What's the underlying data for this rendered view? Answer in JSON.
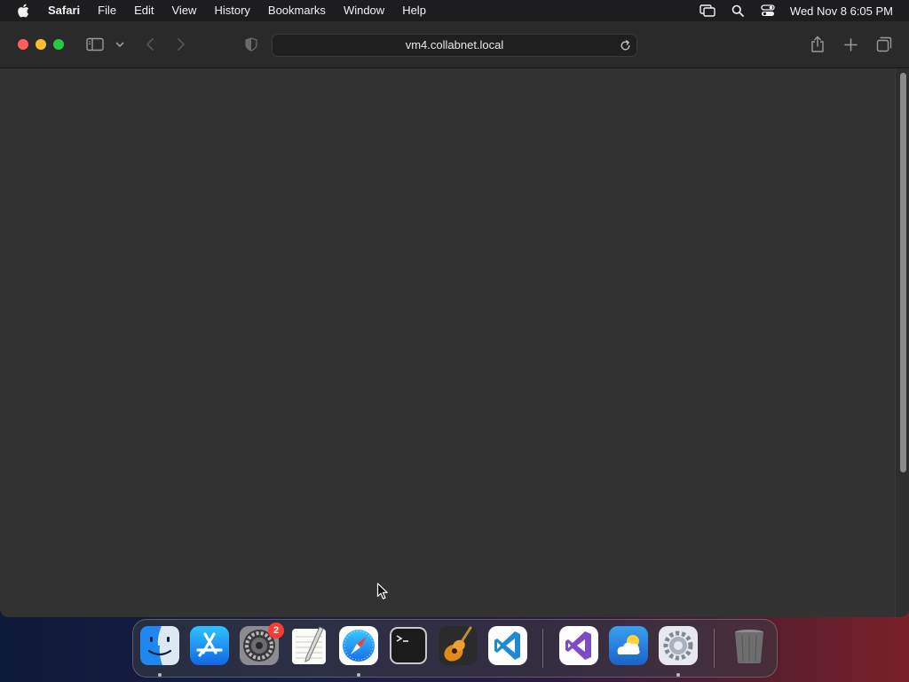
{
  "menubar": {
    "apple_icon": "apple-logo-icon",
    "app_name": "Safari",
    "items": [
      "File",
      "Edit",
      "View",
      "History",
      "Bookmarks",
      "Window",
      "Help"
    ],
    "status_icons": [
      "screen-mirroring-icon",
      "spotlight-search-icon",
      "control-center-icon"
    ],
    "clock": "Wed Nov 8  6:05 PM"
  },
  "window": {
    "address_bar": {
      "url": "vm4.collabnet.local"
    },
    "toolbar_icons": [
      "sidebar-icon",
      "chevron-down-icon",
      "back-icon",
      "forward-icon",
      "privacy-shield-icon",
      "reload-icon",
      "share-icon",
      "new-tab-icon",
      "tab-overview-icon"
    ]
  },
  "dock": {
    "apps": [
      {
        "name": "Finder",
        "running": true
      },
      {
        "name": "App Store",
        "running": false
      },
      {
        "name": "System Preferences",
        "running": false,
        "badge": "2"
      },
      {
        "name": "TextEdit",
        "running": false
      },
      {
        "name": "Safari",
        "running": true
      },
      {
        "name": "Terminal",
        "running": false
      },
      {
        "name": "GarageBand",
        "running": false
      },
      {
        "name": "Visual Studio Code",
        "running": false
      },
      {
        "name": "Visual Studio",
        "running": false
      },
      {
        "name": "Weather",
        "running": false
      },
      {
        "name": "System Settings",
        "running": true
      },
      {
        "name": "Trash",
        "running": false
      }
    ]
  },
  "colors": {
    "close": "#ff5f57",
    "minimize": "#febc2e",
    "maximize": "#28c840",
    "badge": "#ff3b30",
    "window_bg": "#323232"
  }
}
